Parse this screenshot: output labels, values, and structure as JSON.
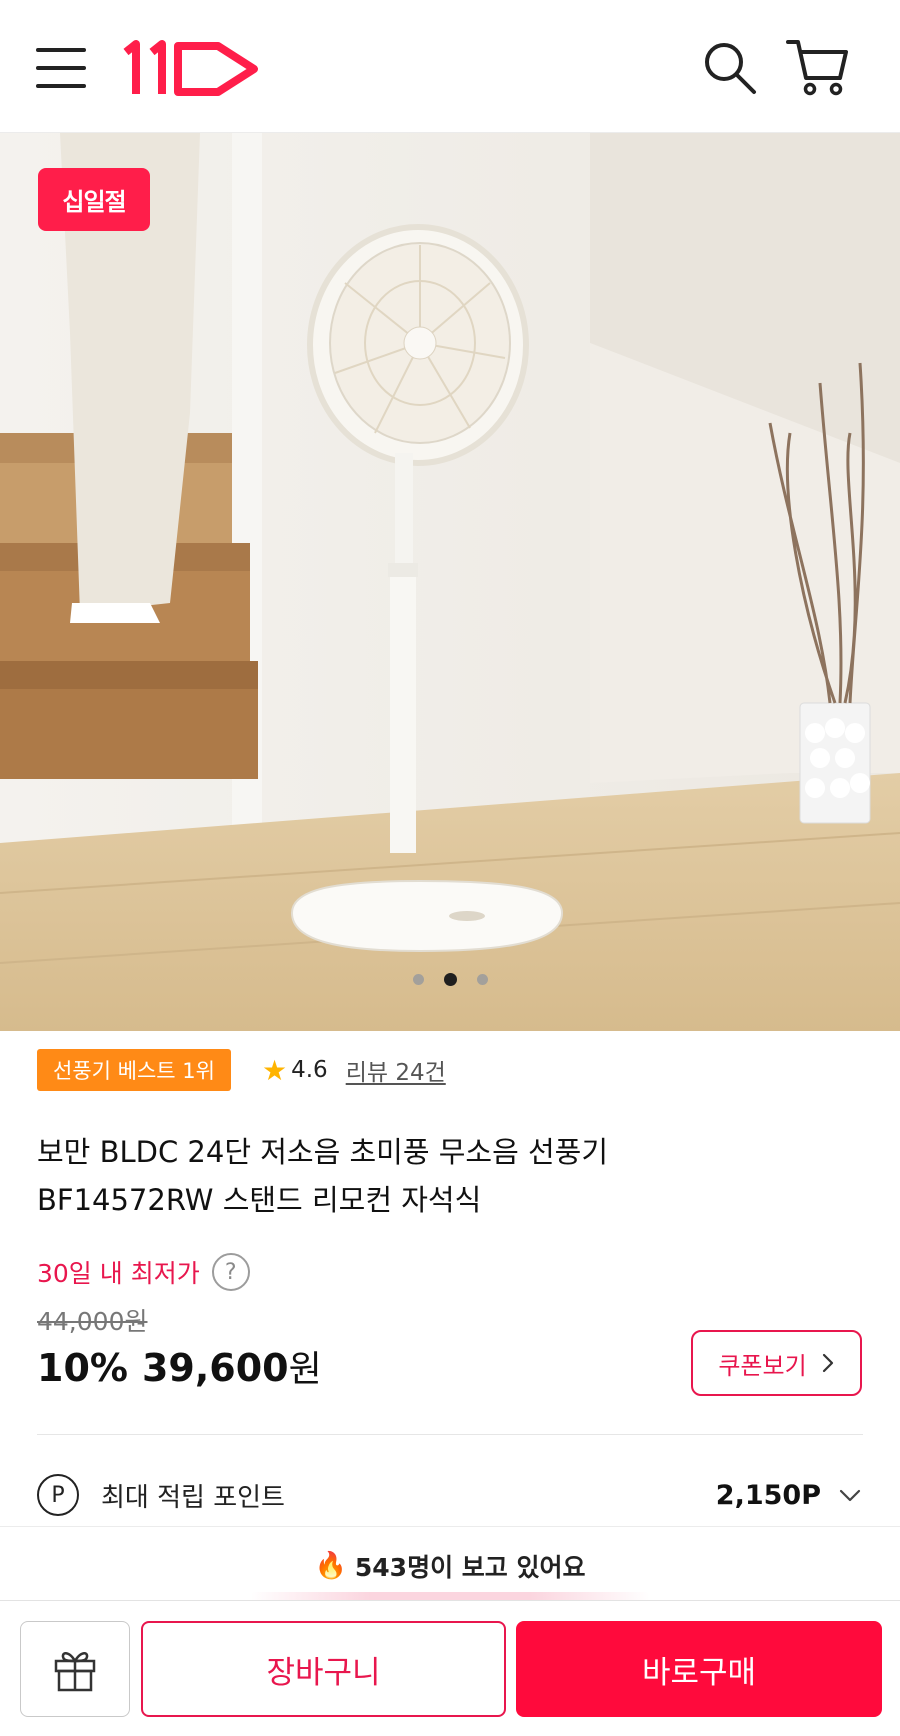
{
  "header": {
    "menu_icon": "hamburger-menu-icon",
    "logo_text": "11",
    "search_icon": "search-icon",
    "cart_icon": "cart-icon",
    "brand_color": "#ff1e4a"
  },
  "hero": {
    "event_badge": "십일절",
    "slides_total": 3,
    "active_slide": 2
  },
  "product": {
    "best_badge": "선풍기 베스트 1위",
    "rating": "4.6",
    "review_link": "리뷰 24건",
    "title_line1": "보만 BLDC 24단 저소음 초미풍 무소음 선풍기",
    "title_line2": "BF14572RW 스탠드 리모컨 자석식"
  },
  "price": {
    "lowest_label": "30일 내 최저가",
    "help_icon": "?",
    "original": "44,000원",
    "discount_pct": "10%",
    "sale_amount": "39,600",
    "sale_unit": "원",
    "coupon_label": "쿠폰보기",
    "accent_color": "#e8164d"
  },
  "points": {
    "icon_letter": "P",
    "label": "최대 적립 포인트",
    "value": "2,150P"
  },
  "viewing": {
    "text": "543명이 보고 있어요"
  },
  "bottom_bar": {
    "gift_icon": "gift-icon",
    "cart_label": "장바구니",
    "buy_label": "바로구매"
  }
}
